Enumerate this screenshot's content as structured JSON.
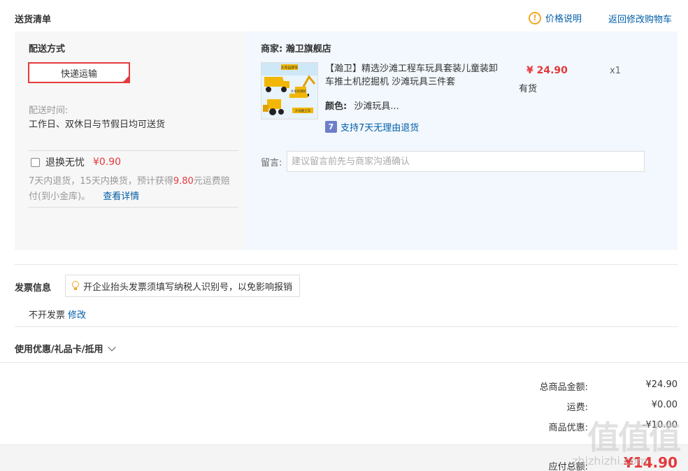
{
  "header": {
    "title": "送货清单",
    "price_note": "价格说明",
    "back_to_cart": "返回修改购物车"
  },
  "shipping": {
    "label": "配送方式",
    "method": "快递运输",
    "time_label": "配送时间:",
    "time_text": "工作日、双休日与节假日均可送货"
  },
  "insurance": {
    "label": "退换无忧",
    "price": "¥0.90",
    "desc_prefix": "7天内退货，15天内换货，预计获得",
    "desc_amount": "9.80",
    "desc_suffix": "元运费赔付(到小金库)。",
    "details_link": "查看详情"
  },
  "shop": {
    "label": "商家:",
    "name": "瀚卫旗舰店"
  },
  "product": {
    "name": "【瀚卫】精选沙滩工程车玩具套装儿童装卸车推土机挖掘机 沙滩玩具三件套",
    "color_label": "颜色:",
    "color_value": "沙滩玩具...",
    "return_icon": "7",
    "return_policy": "支持7天无理由退货",
    "price": "¥ 24.90",
    "stock": "有货",
    "quantity": "x1",
    "thumb_label_1": "大号自卸车",
    "thumb_label_2": "大号挖掘机",
    "thumb_label_3": "大号推土车"
  },
  "message": {
    "label": "留言:",
    "placeholder": "建议留言前先与商家沟通确认"
  },
  "invoice": {
    "title": "发票信息",
    "tip": "开企业抬头发票须填写纳税人识别号，以免影响报销",
    "state": "不开发票",
    "edit": "修改"
  },
  "coupon": {
    "label": "使用优惠/礼品卡/抵用"
  },
  "summary": {
    "goods_total_label": "总商品金额:",
    "goods_total": "¥24.90",
    "freight_label": "运费:",
    "freight": "¥0.00",
    "discount_label": "商品优惠:",
    "discount": "-¥10.00",
    "payable_label": "应付总额:",
    "payable": "¥14.90"
  },
  "watermark": {
    "logo": "值值值",
    "site": "zhizhizhi.com"
  },
  "colors": {
    "accent_red": "#e4393c",
    "link_blue": "#005ea7",
    "panel_gray": "#f7f7f7",
    "panel_blue": "#f3f8fe",
    "warn_orange": "#f5a623"
  }
}
